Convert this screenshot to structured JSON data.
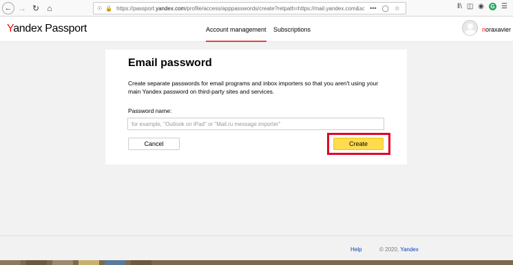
{
  "browser": {
    "url_prefix": "https://passport.",
    "url_domain": "yandex.com",
    "url_rest": "/profile/access/apppasswords/create?retpath=https://mail.yandex.com&scope...",
    "page_actions": "•••"
  },
  "header": {
    "logo_y": "Y",
    "logo_andex": "andex",
    "logo_passport": "Passport",
    "nav": [
      {
        "label": "Account management"
      },
      {
        "label": "Subscriptions"
      }
    ],
    "username_first": "n",
    "username_rest": "oraxavier"
  },
  "main": {
    "title": "Email password",
    "description": "Create separate passwords for email programs and inbox importers so that you aren't using your main Yandex password on third-party sites and services.",
    "field_label": "Password name:",
    "field_placeholder": "for example, \"Outlook on iPad\" or \"Mail.ru message importer\"",
    "field_value": "",
    "cancel_label": "Cancel",
    "create_label": "Create"
  },
  "footer": {
    "help": "Help",
    "copyright": "© 2020,",
    "brand": "Yandex"
  },
  "colors": {
    "accent_yellow": "#ffdb4d",
    "highlight_red": "#e1001f",
    "tab_underline": "#e0443b",
    "link_blue": "#0044bb"
  }
}
